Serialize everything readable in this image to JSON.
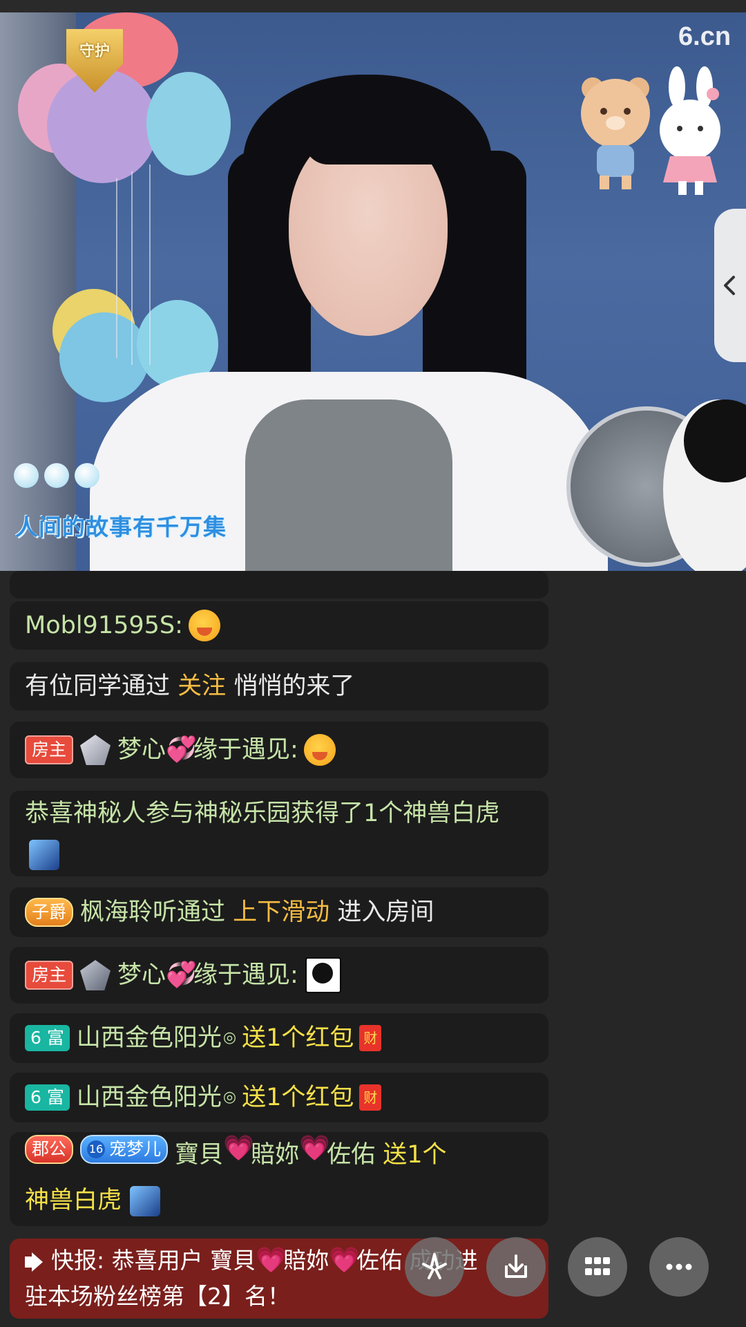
{
  "stream": {
    "watermark": "6.cn",
    "guard_badge": "守护",
    "lyric": "人间的故事有千万集"
  },
  "chat": {
    "messages": [
      {
        "user": "Mobl91595S:"
      },
      {
        "pre": "有位同学通过",
        "highlight": "关注",
        "post": "悄悄的来了"
      },
      {
        "badge": "房主",
        "user": "梦心",
        "user2": "缘于遇见:"
      },
      {
        "text1": "恭喜神秘人参与神秘乐园获得了1个神兽",
        "text2": "白虎"
      },
      {
        "badge": "子爵",
        "user": "枫海聆听通过",
        "highlight": "上下滑动",
        "post": "进入房间"
      },
      {
        "badge": "房主",
        "user": "梦心",
        "user2": "缘于遇见:"
      },
      {
        "badge": "6 富",
        "user": "山西金色阳光",
        "action": "送1个红包",
        "icon": "财"
      },
      {
        "badge": "6 富",
        "user": "山西金色阳光",
        "action": "送1个红包",
        "icon": "财"
      },
      {
        "badge": "郡公",
        "fan_level": "16",
        "fan_badge": "宠梦儿",
        "user_a": "寶貝",
        "user_b": "賠妳",
        "user_c": "佐佑",
        "action": "送1个",
        "gift": "神兽白虎"
      }
    ]
  },
  "broadcast": {
    "line1": "快报: 恭喜用户 寶貝",
    "line1b": "賠妳",
    "line1c": "佐佑 成功进",
    "line2": "驻本场粉丝榜第【2】名！"
  },
  "controls": {
    "share_icon": "share-icon",
    "download_icon": "download-icon",
    "grid_icon": "grid-icon",
    "more_icon": "more-icon"
  },
  "colors": {
    "chat_bg": "#1c1c1c",
    "highlight_orange": "#f5bc42",
    "highlight_yellow": "#f5e048",
    "username_green": "#c6e4a8",
    "broadcast_bg": "#7a1f1c"
  }
}
